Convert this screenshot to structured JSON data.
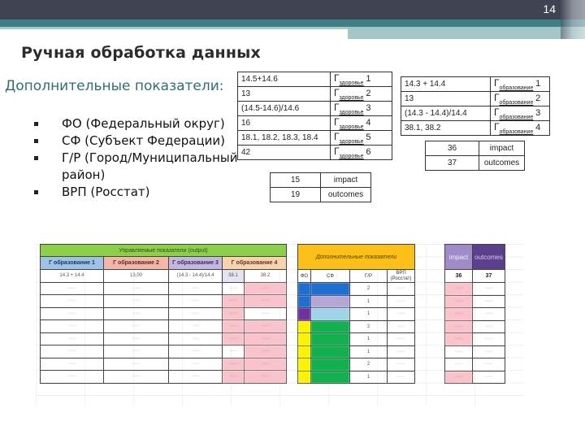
{
  "slide": {
    "number": "14",
    "title": "Ручная обработка данных",
    "subtitle": "Дополнительные показатели:"
  },
  "bullets": [
    "ФО (Федеральный округ)",
    "СФ (Субъект Федерации)",
    "Г/Р (Город/Муниципальный район)",
    "ВРП (Росстат)"
  ],
  "health_table": {
    "symbol": "Г",
    "subscript": "здоровье",
    "rows": [
      {
        "formula": "14.5+14.6",
        "index": "1"
      },
      {
        "formula": "13",
        "index": "2"
      },
      {
        "formula": "(14.5-14.6)/14.6",
        "index": "3"
      },
      {
        "formula": "16",
        "index": "4"
      },
      {
        "formula": "18.1, 18.2, 18.3, 18.4",
        "index": "5"
      },
      {
        "formula": "42",
        "index": "6"
      }
    ]
  },
  "health_io_table": {
    "rows": [
      {
        "code": "15",
        "label": "impact"
      },
      {
        "code": "19",
        "label": "outcomes"
      }
    ]
  },
  "education_table": {
    "symbol": "Г",
    "subscript": "образование",
    "rows": [
      {
        "formula": "14.3 + 14.4",
        "index": "1"
      },
      {
        "formula": "13",
        "index": "2"
      },
      {
        "formula": "(14.3 - 14.4)/14.4",
        "index": "3"
      },
      {
        "formula": "38.1, 38.2",
        "index": "4"
      }
    ]
  },
  "education_io_table": {
    "rows": [
      {
        "code": "36",
        "label": "impact"
      },
      {
        "code": "37",
        "label": "outcomes"
      }
    ]
  },
  "spreadsheet": {
    "output_block": {
      "title": "Управляемые показатели (output)",
      "headers": [
        "Г образование 1",
        "Г образование 2",
        "Г образование 3",
        "Г образование 4"
      ],
      "formulas": [
        "14.3 + 14.4",
        "13,00",
        "(14.3 - 14.4)/14.4",
        "38.1",
        "38.2"
      ],
      "row_placeholder": "·····"
    },
    "extra_block": {
      "title": "Дополнительные показатели",
      "headers": [
        "ФО",
        "СФ",
        "Г/Р",
        "ВРП (Росстат)"
      ],
      "gr_values": [
        "2",
        "1",
        "1",
        "2",
        "1",
        "1",
        "2",
        "1"
      ]
    },
    "io_block": {
      "headers": [
        "impact",
        "outcomes"
      ],
      "codes": [
        "36",
        "37"
      ]
    }
  }
}
